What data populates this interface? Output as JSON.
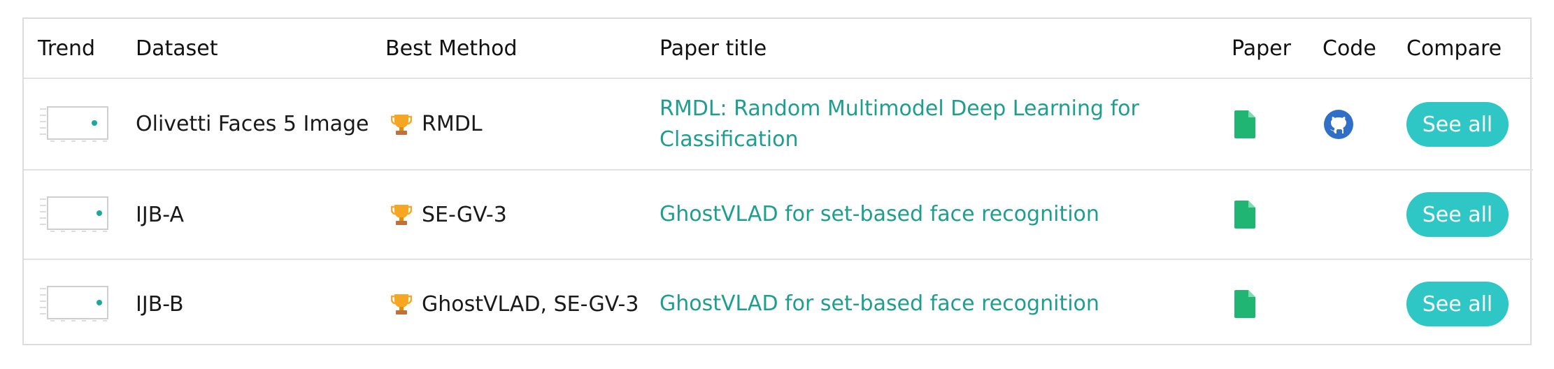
{
  "headers": {
    "trend": "Trend",
    "dataset": "Dataset",
    "best_method": "Best Method",
    "paper_title": "Paper title",
    "paper": "Paper",
    "code": "Code",
    "compare": "Compare"
  },
  "rows": [
    {
      "dataset": "Olivetti Faces 5 Image",
      "method": "RMDL",
      "title_line1": "RMDL: Random Multimodel Deep Learning for",
      "title_line2": "Classification",
      "has_code": true,
      "compare": "See all"
    },
    {
      "dataset": "IJB-A",
      "method": "SE-GV-3",
      "title_line1": "GhostVLAD for set-based face recognition",
      "title_line2": "",
      "has_code": false,
      "compare": "See all"
    },
    {
      "dataset": "IJB-B",
      "method": "GhostVLAD, SE-GV-3",
      "title_line1": "GhostVLAD for set-based face recognition",
      "title_line2": "",
      "has_code": false,
      "compare": "See all"
    }
  ],
  "icons": {
    "trend": "sparkline-chart-icon",
    "method": "trophy-icon",
    "paper": "paper-document-icon",
    "code": "github-icon"
  },
  "colors": {
    "link": "#1e9e8f",
    "button": "#2fc6c6",
    "paper_icon": "#21b573",
    "github_icon": "#2f6fc9",
    "border": "#dcdcdc"
  }
}
